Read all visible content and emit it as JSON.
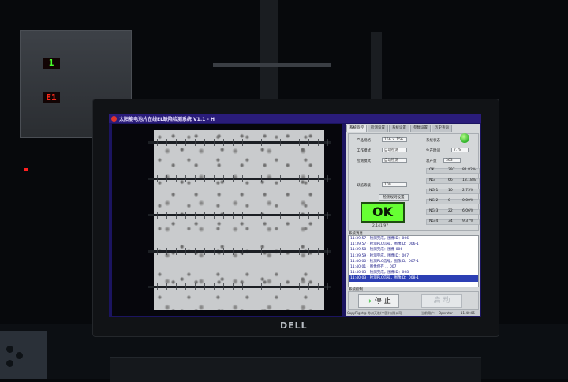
{
  "room": {
    "panel_readout_top": "1",
    "panel_readout_bottom": "E1",
    "monitor_brand": "DELL"
  },
  "window": {
    "title": "太阳能电池片在线EL缺陷检测系统 V1.1 - H"
  },
  "tabs": [
    {
      "label": "系统监控"
    },
    {
      "label": "检测设置"
    },
    {
      "label": "系统设置"
    },
    {
      "label": "参数设置"
    },
    {
      "label": "历史查询"
    }
  ],
  "form": {
    "product_label": "产品规格",
    "product_value": "156 × 156",
    "work_mode_label": "工作模式",
    "work_mode_value": "自动检测",
    "detect_mode_label": "检测模式",
    "detect_mode_value": "自动检测",
    "grade_label": "缺陷等级",
    "grade_value": "100",
    "rules_button": "检测规则设置",
    "system_state_label": "系统状态",
    "produced_label": "生产时间",
    "produced_value": "7.78",
    "output_label": "总产量",
    "output_value": "363"
  },
  "status_lamp_color": "#2fb32a",
  "stats": [
    {
      "name": "OK",
      "count": "297",
      "pct": "81.82%"
    },
    {
      "name": "NG",
      "count": "66",
      "pct": "18.18%"
    },
    {
      "name": "NG-1",
      "count": "10",
      "pct": "2.75%"
    },
    {
      "name": "NG-2",
      "count": "0",
      "pct": "0.00%"
    },
    {
      "name": "NG-3",
      "count": "22",
      "pct": "6.06%"
    },
    {
      "name": "NG-4",
      "count": "34",
      "pct": "9.37%"
    }
  ],
  "result": {
    "label": "OK",
    "time": "2.141/97"
  },
  "log": {
    "title": "系统消息",
    "lines": [
      "11:39:57 - 检测完成，图像ID：006",
      "11:39:57 - 检测PLC信号，图像ID：006-1",
      "11:39:58 - 检测完成：图像 006",
      "11:39:59 - 检测完成，图像ID：007",
      "11:40:00 - 检测PLC信号，图像ID：007-1",
      "11:40:01 - 图像保存 ... 007",
      "11:40:03 - 检测完成，图像ID：008",
      "11:40:03 - 检测PLC信号，图像ID：008-1"
    ],
    "selected_index": 7
  },
  "control": {
    "title": "系统控制",
    "stop_label": "停 止",
    "start_label": "启 动"
  },
  "statusbar": {
    "copyright": "CopyRight@ 苏州天准(中国)有限公司",
    "user_label": "当前用户：",
    "user": "Operator",
    "time": "11:40:05"
  },
  "accent_colors": {
    "ok_green": "#66ff33",
    "title_bar": "#2a1c7a",
    "log_selection": "#2c3fb4"
  }
}
